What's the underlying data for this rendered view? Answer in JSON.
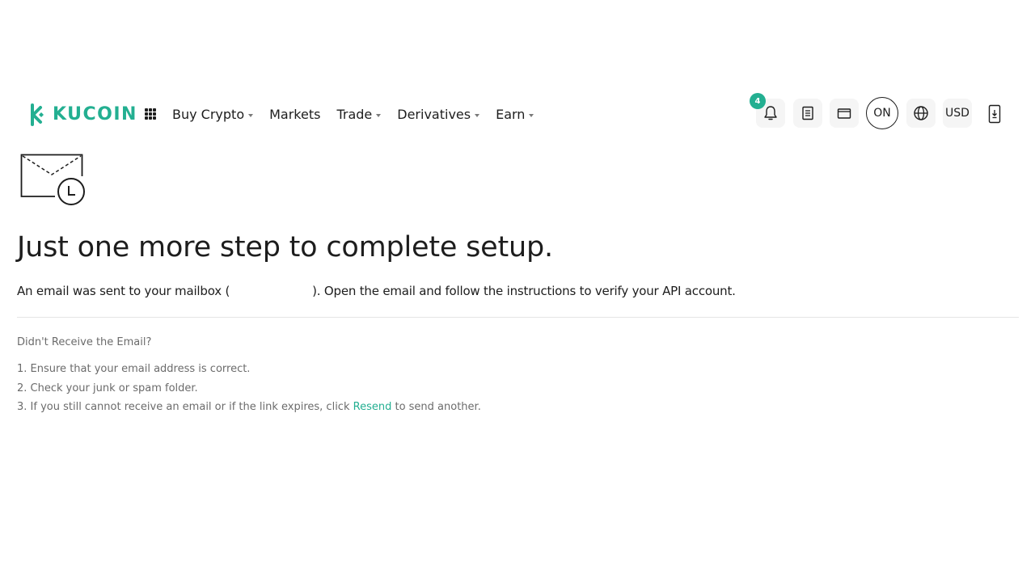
{
  "brand": {
    "name": "KUCOIN",
    "accent_color": "#23af91"
  },
  "nav": {
    "items": [
      {
        "label": "Buy Crypto",
        "has_dropdown": true
      },
      {
        "label": "Markets",
        "has_dropdown": false
      },
      {
        "label": "Trade",
        "has_dropdown": true
      },
      {
        "label": "Derivatives",
        "has_dropdown": true
      },
      {
        "label": "Earn",
        "has_dropdown": true
      }
    ]
  },
  "toolbar": {
    "notification_count": "4",
    "notification_icon": "bell-icon",
    "orders_icon": "document-icon",
    "assets_icon": "wallet-icon",
    "user_initials": "ON",
    "language_icon": "globe-icon",
    "currency": "USD",
    "download_icon": "phone-download-icon"
  },
  "main": {
    "illustration_icon": "envelope-clock-icon",
    "title": "Just one more step to complete setup.",
    "description_prefix": "An email was sent to your mailbox (",
    "description_suffix": "). Open the email and follow the instructions to verify your API account.",
    "help": {
      "title": "Didn't Receive the Email?",
      "steps": [
        "1. Ensure that your email address is correct.",
        "2. Check your junk or spam folder."
      ],
      "step3_prefix": "3. If you still cannot receive an email or if the link expires, click ",
      "step3_link": "Resend",
      "step3_suffix": " to send another."
    }
  }
}
